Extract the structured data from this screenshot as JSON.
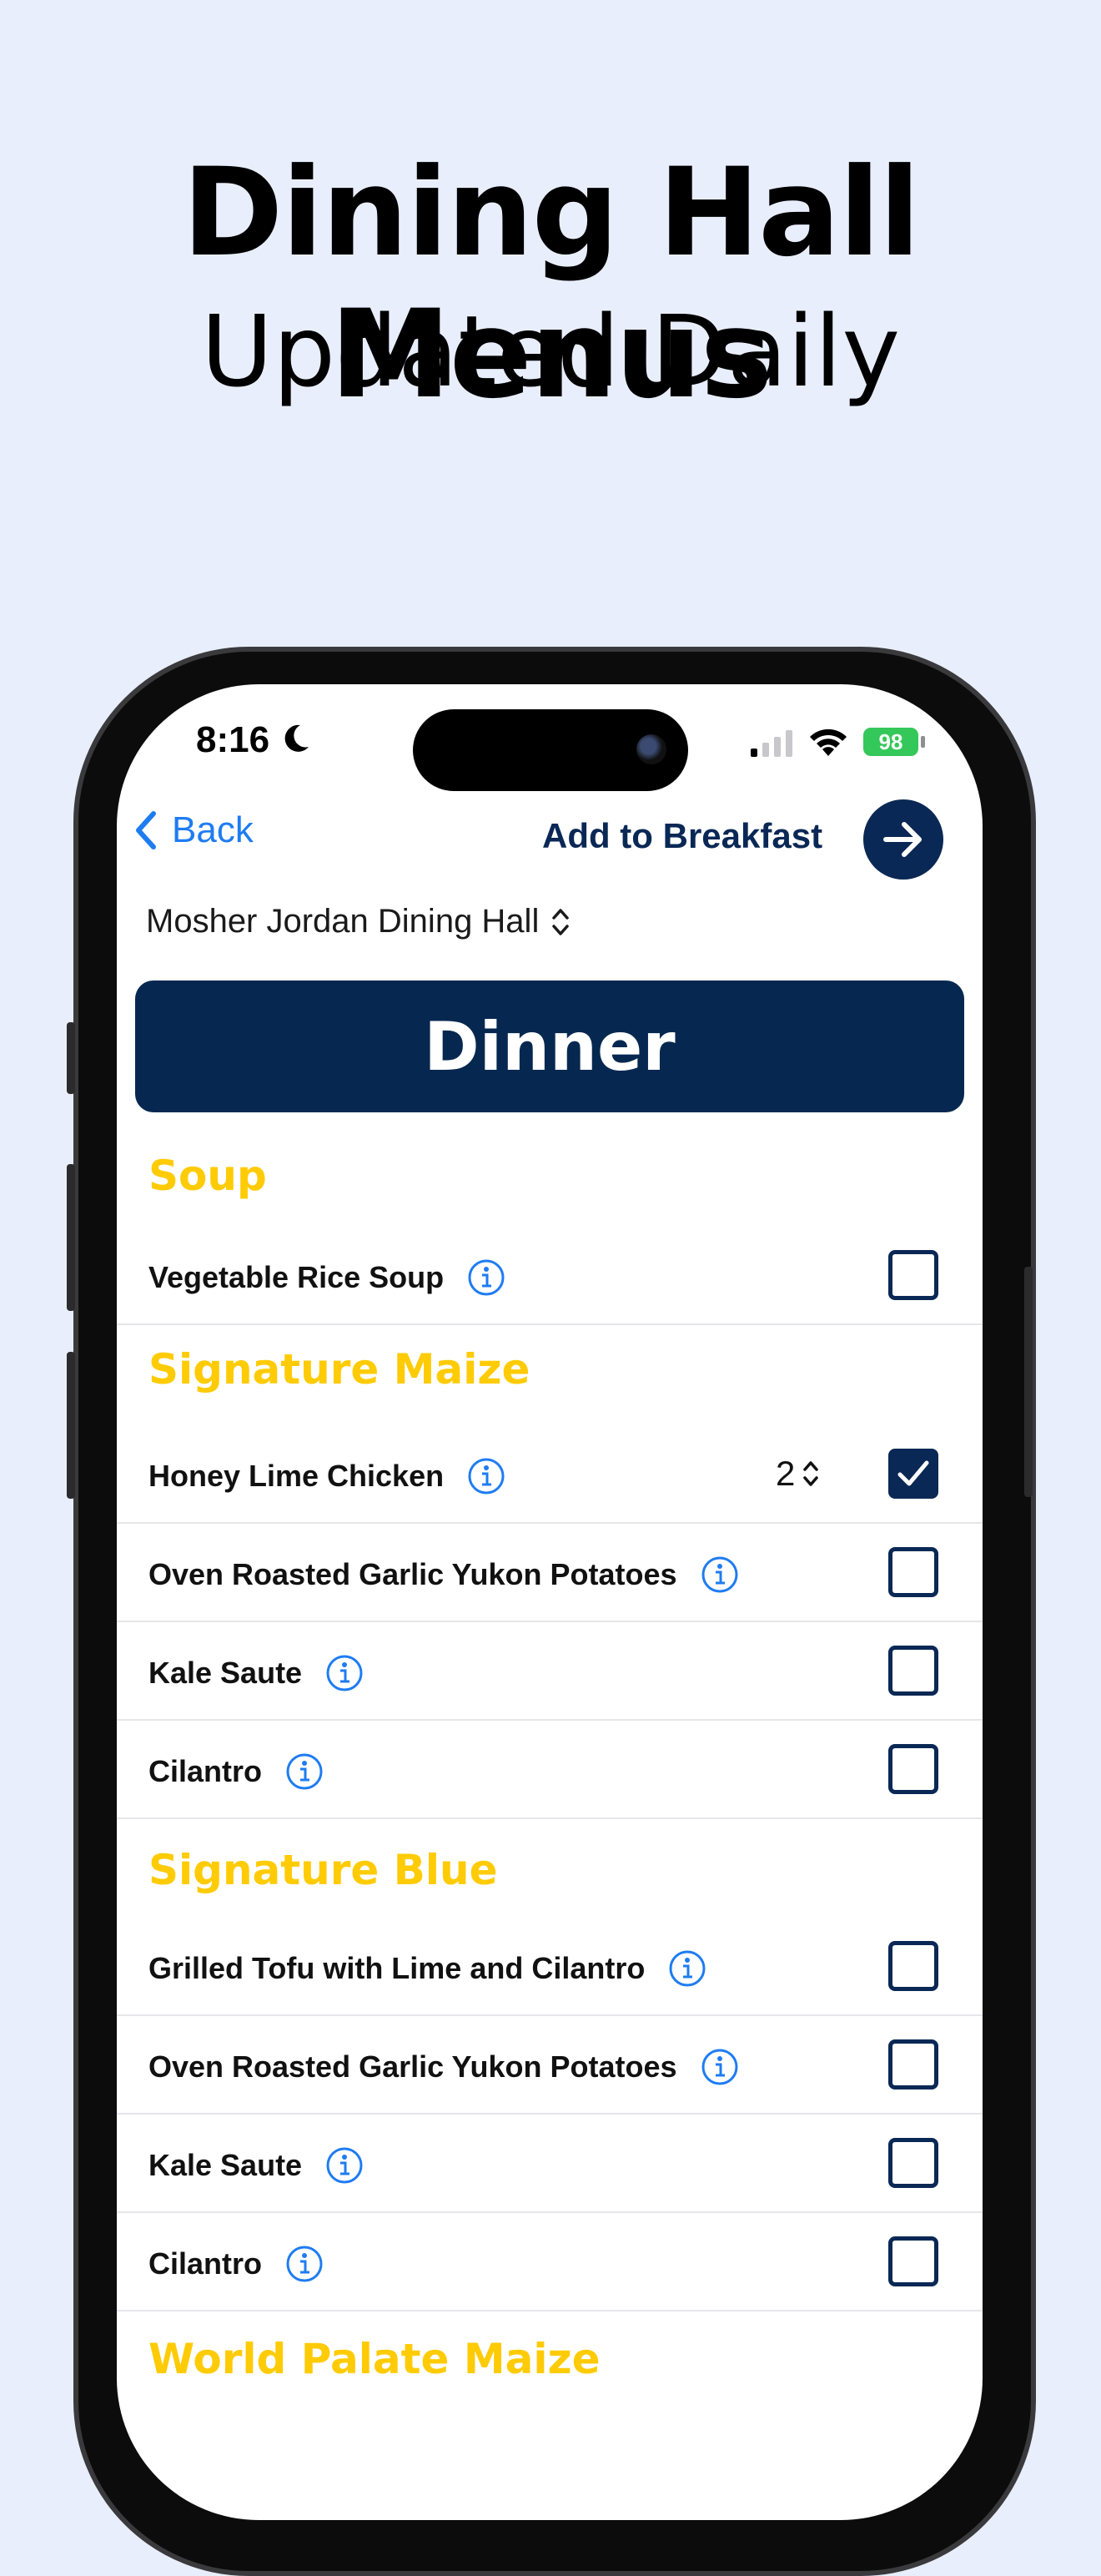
{
  "promo": {
    "headline": "Dining Hall Menus",
    "subline": "Updated Daily"
  },
  "status_bar": {
    "time": "8:16",
    "battery": "98"
  },
  "nav": {
    "back_label": "Back",
    "add_label": "Add to Breakfast"
  },
  "dining_hall": "Mosher Jordan Dining Hall",
  "meal": "Dinner",
  "sections": [
    {
      "title": "Soup",
      "items": [
        {
          "name": "Vegetable Rice Soup",
          "checked": false
        }
      ]
    },
    {
      "title": "Signature Maize",
      "items": [
        {
          "name": "Honey Lime Chicken",
          "checked": true,
          "quantity": "2"
        },
        {
          "name": "Oven Roasted Garlic Yukon Potatoes",
          "checked": false
        },
        {
          "name": "Kale Saute",
          "checked": false
        },
        {
          "name": "Cilantro",
          "checked": false
        }
      ]
    },
    {
      "title": "Signature Blue",
      "items": [
        {
          "name": "Grilled Tofu with Lime and Cilantro",
          "checked": false
        },
        {
          "name": "Oven Roasted Garlic Yukon Potatoes",
          "checked": false
        },
        {
          "name": "Kale Saute",
          "checked": false
        },
        {
          "name": "Cilantro",
          "checked": false
        }
      ]
    },
    {
      "title": "World Palate Maize",
      "items": []
    }
  ],
  "colors": {
    "navy": "#0a2855",
    "maize": "#ffcb05",
    "link_blue": "#1e7cf2",
    "background": "#e9eefc"
  },
  "icons": [
    "chevron-left-icon",
    "arrow-right-icon",
    "chevron-up-down-icon",
    "info-icon",
    "checkmark-icon",
    "moon-icon",
    "wifi-icon",
    "signal-icon"
  ]
}
